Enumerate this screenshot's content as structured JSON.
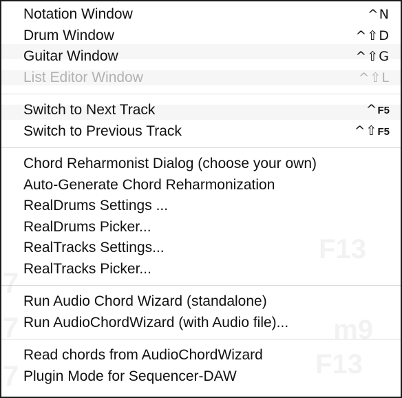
{
  "menu": {
    "groups": [
      {
        "items": [
          {
            "label": "Notation Window",
            "shortcut_mod": "^",
            "shortcut_key": "N",
            "enabled": true
          },
          {
            "label": "Drum Window",
            "shortcut_mod": "^⇧",
            "shortcut_key": "D",
            "enabled": true
          },
          {
            "label": "Guitar Window",
            "shortcut_mod": "^⇧",
            "shortcut_key": "G",
            "enabled": true
          },
          {
            "label": "List Editor Window",
            "shortcut_mod": "^⇧",
            "shortcut_key": "L",
            "enabled": false
          }
        ]
      },
      {
        "items": [
          {
            "label": "Switch to Next Track",
            "shortcut_mod": "^",
            "shortcut_key": "F5",
            "enabled": true
          },
          {
            "label": "Switch to Previous Track",
            "shortcut_mod": "^⇧",
            "shortcut_key": "F5",
            "enabled": true
          }
        ]
      },
      {
        "items": [
          {
            "label": "Chord Reharmonist Dialog (choose your own)",
            "enabled": true
          },
          {
            "label": "Auto-Generate Chord Reharmonization",
            "enabled": true
          },
          {
            "label": "RealDrums Settings ...",
            "enabled": true
          },
          {
            "label": "RealDrums Picker...",
            "enabled": true
          },
          {
            "label": "RealTracks Settings...",
            "enabled": true
          },
          {
            "label": "RealTracks Picker...",
            "enabled": true
          }
        ]
      },
      {
        "items": [
          {
            "label": "Run Audio Chord Wizard (standalone)",
            "enabled": true
          },
          {
            "label": "Run AudioChordWizard (with Audio file)...",
            "enabled": true
          }
        ]
      },
      {
        "items": [
          {
            "label": "Read chords from AudioChordWizard",
            "enabled": true
          },
          {
            "label": "Plugin Mode for Sequencer-DAW",
            "enabled": true
          }
        ]
      }
    ]
  },
  "background": {
    "ghost_texts": [
      "F13",
      "m9",
      "F13",
      "7",
      "7",
      "7"
    ]
  }
}
